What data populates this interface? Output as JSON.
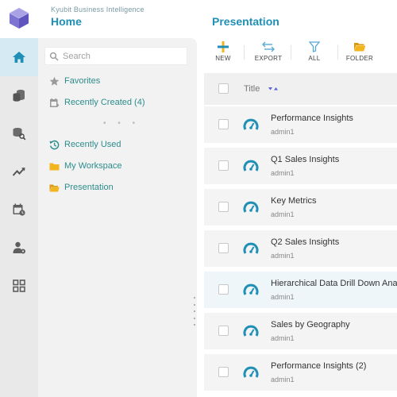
{
  "header": {
    "brand": "Kyubit Business Intelligence",
    "home_title": "Home",
    "page_title": "Presentation"
  },
  "rail": {
    "items": [
      {
        "icon": "home-icon",
        "active": true
      },
      {
        "icon": "database-icon",
        "active": false
      },
      {
        "icon": "database-search-icon",
        "active": false
      },
      {
        "icon": "trend-chart-icon",
        "active": false
      },
      {
        "icon": "calendar-clock-icon",
        "active": false
      },
      {
        "icon": "user-settings-icon",
        "active": false
      },
      {
        "icon": "grid-icon",
        "active": false
      }
    ]
  },
  "sidebar": {
    "search_placeholder": "Search",
    "items": [
      {
        "label": "Favorites",
        "icon": "star-icon"
      },
      {
        "label": "Recently Created (4)",
        "icon": "recently-created-icon"
      },
      {
        "label": "Recently Used",
        "icon": "recent-icon"
      },
      {
        "label": "My Workspace",
        "icon": "folder-icon"
      },
      {
        "label": "Presentation",
        "icon": "folder-open-icon"
      }
    ],
    "separator": "• • •"
  },
  "toolbar": {
    "new_label": "NEW",
    "export_label": "EXPORT",
    "all_label": "ALL",
    "folder_label": "FOLDER"
  },
  "table": {
    "column_title": "Title",
    "rows": [
      {
        "name": "Performance Insights",
        "owner": "admin1"
      },
      {
        "name": "Q1 Sales Insights",
        "owner": "admin1"
      },
      {
        "name": "Key Metrics",
        "owner": "admin1"
      },
      {
        "name": "Q2 Sales Insights",
        "owner": "admin1"
      },
      {
        "name": "Hierarchical Data Drill Down Ana",
        "owner": "admin1"
      },
      {
        "name": "Sales by Geography",
        "owner": "admin1"
      },
      {
        "name": "Performance Insights (2)",
        "owner": "admin1"
      }
    ]
  },
  "colors": {
    "accent": "#1f8fb6",
    "nav_text": "#2e8c8c",
    "folder": "#f2b51d",
    "active_rail": "#d6eaf3"
  }
}
